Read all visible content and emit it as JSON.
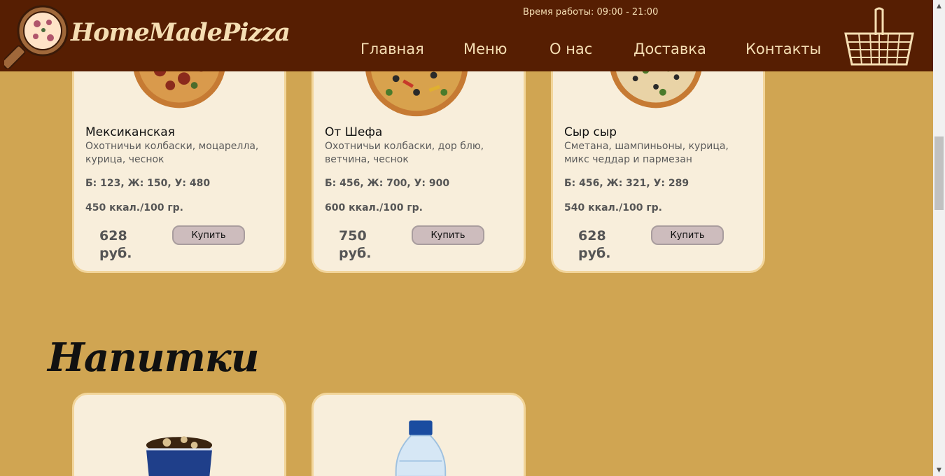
{
  "header": {
    "logo_text": "HomeMadePizza",
    "working_hours": "Время работы: 09:00 - 21:00",
    "nav": [
      "Главная",
      "Меню",
      "О нас",
      "Доставка",
      "Контакты"
    ]
  },
  "pizzas": [
    {
      "title": "Мексиканская",
      "desc": "Охотничьи колбаски, моцарелла, курица, чеснок",
      "bju": "Б: 123, Ж: 150, У: 480",
      "kcal": "450 ккал./100 гр.",
      "price": "628 руб.",
      "buy": "Купить"
    },
    {
      "title": "От Шефа",
      "desc": "Охотничьи колбаски, дор блю, ветчина, чеснок",
      "bju": "Б: 456, Ж: 700, У: 900",
      "kcal": "600 ккал./100 гр.",
      "price": "750 руб.",
      "buy": "Купить"
    },
    {
      "title": "Сыр сыр",
      "desc": "Сметана, шампиньоны, курица, микс чеддар и пармезан",
      "bju": "Б: 456, Ж: 321, У: 289",
      "kcal": "540 ккал./100 гр.",
      "price": "628 руб.",
      "buy": "Купить"
    }
  ],
  "drinks_section": {
    "title": "Напитки"
  },
  "colors": {
    "background": "#d0a552",
    "header": "#561e02",
    "card": "#f8eedb",
    "card_border": "#f2d59a",
    "accent_text": "#f5deb3",
    "button": "#cdbcbd"
  },
  "icons": {
    "logo": "pizza-peel-icon",
    "basket": "basket-icon"
  }
}
